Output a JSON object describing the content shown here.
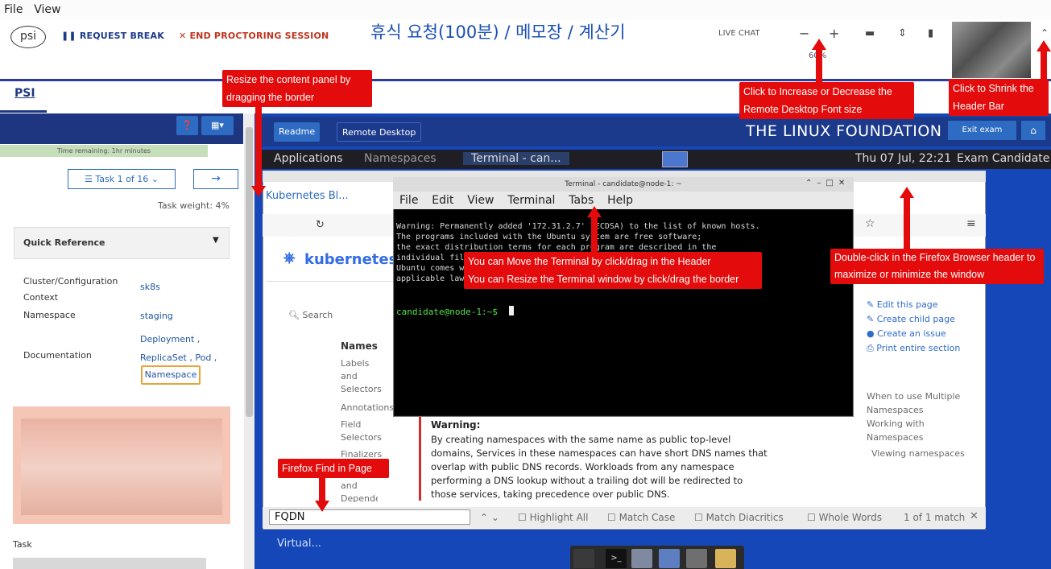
{
  "menubar": {
    "file": "File",
    "view": "View"
  },
  "header": {
    "logo": "psi",
    "request_break": "REQUEST BREAK",
    "end_session": "END PROCTORING SESSION",
    "korean_title": "휴식 요청(100분) / 메모장 / 계산기",
    "live_chat": "LIVE CHAT",
    "zoom_minus": "−",
    "zoom_plus": "+",
    "zoom_level": "60%"
  },
  "psi_tab": "PSI",
  "left_panel": {
    "time_remaining": "Time remaining: 1hr minutes",
    "task_selector": "Task 1 of 16",
    "next_arrow": "→",
    "task_weight": "Task weight: 4%",
    "quick_reference": "Quick Reference",
    "rows": [
      {
        "label": "Cluster/Configuration Context",
        "value": "sk8s"
      },
      {
        "label": "Namespace",
        "value": "staging"
      },
      {
        "label": "Documentation",
        "value": "Deployment , ReplicaSet , Pod ,"
      }
    ],
    "doc_highlight": "Namespace",
    "task_label": "Task"
  },
  "remote_top": {
    "readme": "Readme",
    "remote_desktop": "Remote Desktop",
    "foundation": "THE LINUX FOUNDATION",
    "exit_exam": "Exit exam"
  },
  "xfce_panel": {
    "applications": "Applications",
    "namespaces": "Namespaces",
    "terminal": "Terminal - can...",
    "datetime": "Thu 07 Jul, 22:21",
    "user": "Exam Candidate"
  },
  "firefox": {
    "tab": "Kubernetes Bl...",
    "kubernetes": "kubernetes",
    "search": "Search",
    "names_heading": "Names",
    "sidebar_items": [
      "Labels and Selectors",
      "Annotations",
      "Field Selectors",
      "Finalizers",
      "Owners and Dependents"
    ],
    "warning_title": "Warning:",
    "warning_body": "By creating namespaces with the same name as public top-level domains, Services in these namespaces can have short DNS names that overlap with public DNS records. Workloads from any namespace performing a DNS lookup without a trailing dot will be redirected to those services, taking precedence over public DNS.",
    "right_links": [
      "Edit this page",
      "Create child page",
      "Create an issue",
      "Print entire section"
    ],
    "right_toc": [
      "When to use Multiple Namespaces",
      "Working with Namespaces",
      "Viewing namespaces"
    ],
    "find": {
      "value": "FQDN",
      "highlight_all": "Highlight All",
      "match_case": "Match Case",
      "match_diacritics": "Match Diacritics",
      "whole_words": "Whole Words",
      "result": "1 of 1 match"
    }
  },
  "terminal": {
    "title": "Terminal - candidate@node-1: ~",
    "menu": [
      "File",
      "Edit",
      "View",
      "Terminal",
      "Tabs",
      "Help"
    ],
    "lines": [
      "Warning: Permanently added '172.31.2.7' (ECDSA) to the list of known hosts.",
      "",
      "The programs included with the Ubuntu system are free software;",
      "the exact distribution terms for each program are described in the",
      "individual files in /usr/share/doc/*/copyright.",
      "",
      "Ubuntu comes with ABSOLUTELY NO WARRANTY, to the extent permitted by",
      "applicable law."
    ],
    "prompt": "candidate@node-1:~$"
  },
  "desktop_label": "Virtual...",
  "annotations": {
    "resize_panel": "Resize the content panel by dragging the border",
    "font_size": "Click to Increase or Decrease the Remote Desktop Font size",
    "shrink_header": "Click to Shrink the Header Bar",
    "terminal_move": "You can Move the Terminal by click/drag in the Header",
    "terminal_resize": "You can Resize the Terminal window by click/drag the border",
    "firefox_dblclick": "Double-click in the Firefox Browser header to maximize or minimize the window",
    "find_in_page": "Firefox Find in Page"
  },
  "colors": {
    "psi_blue": "#1e3680",
    "annotation_red": "#e30b0b",
    "desktop_blue": "#1547b8"
  }
}
